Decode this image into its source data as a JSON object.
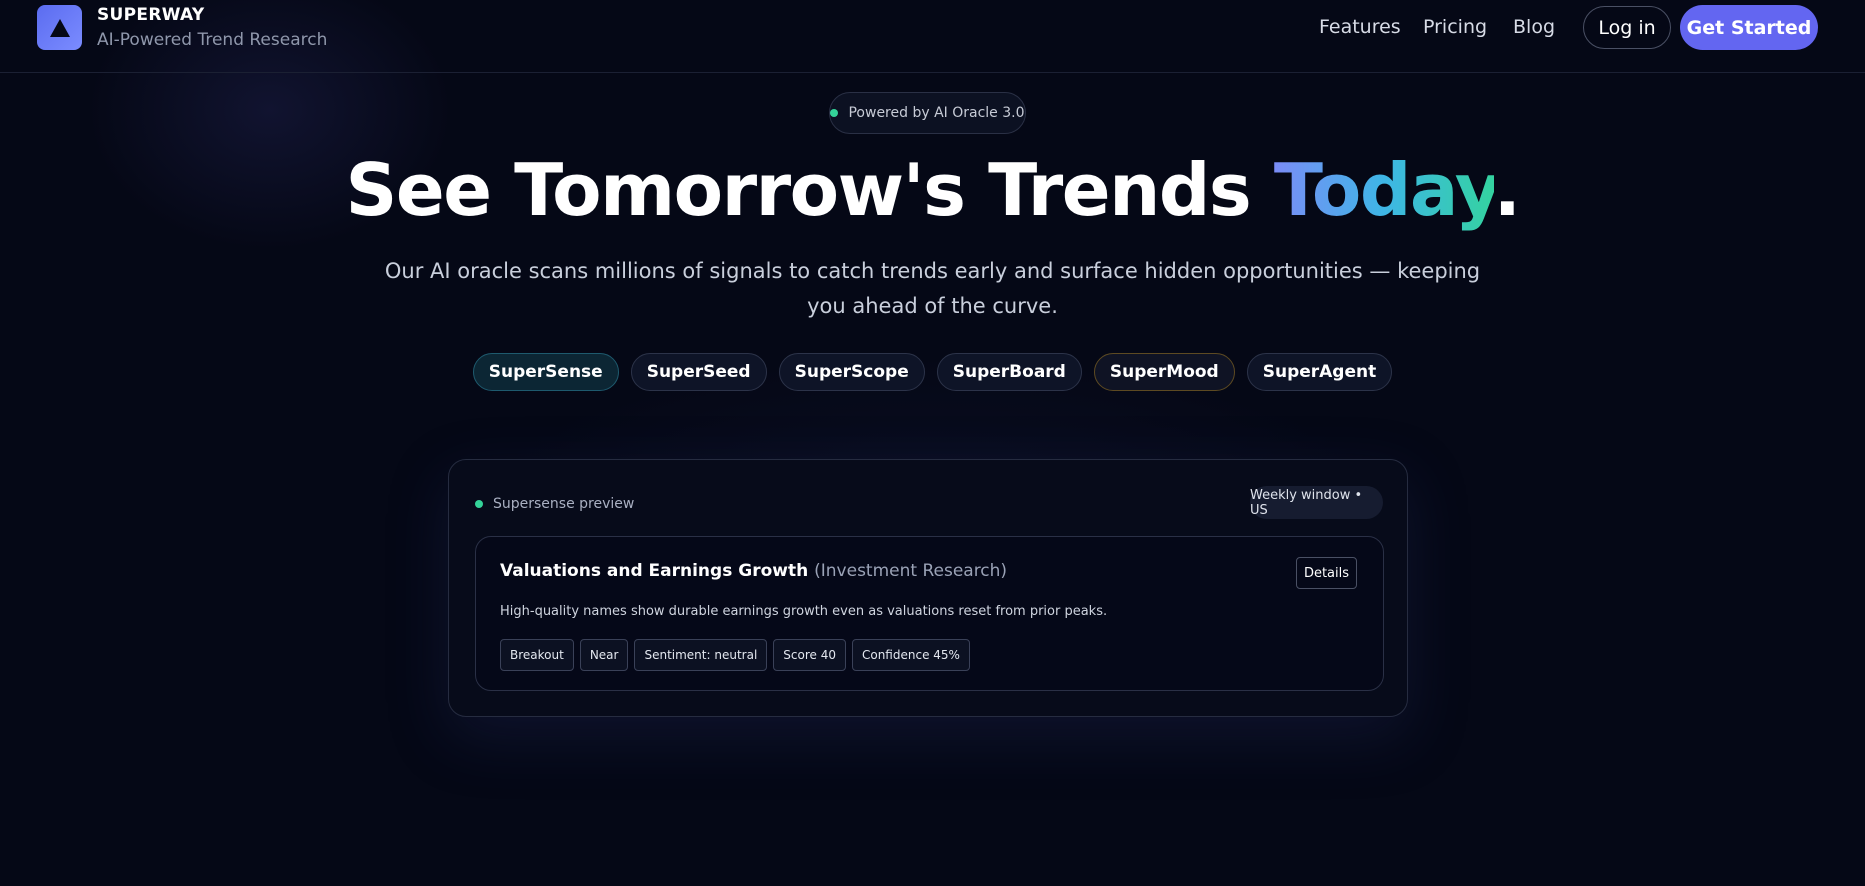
{
  "colors": {
    "background": "#050816",
    "brand": "#6366f1",
    "accent_gradient": [
      "#7b8cf7",
      "#3eb6e6",
      "#34d3a0"
    ],
    "status_green": "#34d399"
  },
  "header": {
    "brand_name": "SUPERWAY",
    "brand_tagline": "AI-Powered Trend Research",
    "logo_icon": "triangle-icon",
    "nav": [
      {
        "label": "Features"
      },
      {
        "label": "Pricing"
      },
      {
        "label": "Blog"
      }
    ],
    "login_label": "Log in",
    "cta_label": "Get Started"
  },
  "hero": {
    "badge": "Powered by AI Oracle 3.0",
    "title_main": "See Tomorrow's Trends ",
    "title_accent": "Today",
    "title_end": ".",
    "subtitle": "Our AI oracle scans millions of signals to catch trends early and surface hidden opportunities — keeping you ahead of the curve."
  },
  "products": [
    {
      "label": "SuperSense",
      "state": "active"
    },
    {
      "label": "SuperSeed"
    },
    {
      "label": "SuperScope"
    },
    {
      "label": "SuperBoard"
    },
    {
      "label": "SuperMood"
    },
    {
      "label": "SuperAgent"
    }
  ],
  "preview": {
    "label": "Supersense preview",
    "window_badge": "Weekly window • US",
    "card": {
      "title": "Valuations and Earnings Growth",
      "category": "(Investment Research)",
      "details_label": "Details",
      "description": "High-quality names show durable earnings growth even as valuations reset from prior peaks.",
      "tags": [
        "Breakout",
        "Near",
        "Sentiment: neutral",
        "Score 40",
        "Confidence 45%"
      ]
    }
  }
}
